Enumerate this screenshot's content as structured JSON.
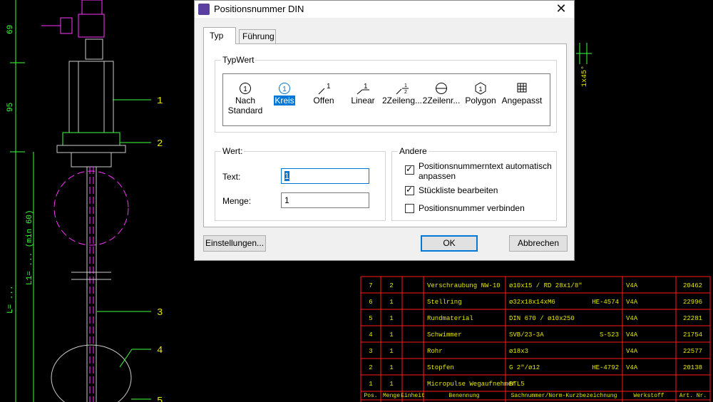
{
  "window": {
    "title": "Positionsnummer DIN",
    "close_glyph": "✕"
  },
  "tabs": [
    {
      "label": "Typ",
      "active": true
    },
    {
      "label": "Führung",
      "active": false
    }
  ],
  "typwert": {
    "label": "TypWert",
    "items": [
      {
        "label": "Nach Standard",
        "icon": "circle-one-icon",
        "selected": false
      },
      {
        "label": "Kreis",
        "icon": "circle-one-icon",
        "selected": true
      },
      {
        "label": "Offen",
        "icon": "leader-open-icon",
        "selected": false
      },
      {
        "label": "Linear",
        "icon": "leader-linear-icon",
        "selected": false
      },
      {
        "label": "2Zeileng...",
        "icon": "two-line-fraction-icon",
        "selected": false
      },
      {
        "label": "2Zeilenr...",
        "icon": "two-line-circle-icon",
        "selected": false
      },
      {
        "label": "Polygon",
        "icon": "polygon-icon",
        "selected": false
      },
      {
        "label": "Angepasst",
        "icon": "grid-icon",
        "selected": false
      }
    ]
  },
  "wert": {
    "label": "Wert:",
    "text_label": "Text:",
    "text_value": "1",
    "menge_label": "Menge:",
    "menge_value": "1"
  },
  "andere": {
    "label": "Andere",
    "options": [
      {
        "label": "Positionsnummerntext automatisch anpassen",
        "checked": true
      },
      {
        "label": "Stückliste bearbeiten",
        "checked": true
      },
      {
        "label": "Positionsnummer verbinden",
        "checked": false
      }
    ]
  },
  "buttons": {
    "settings": "Einstellungen...",
    "ok": "OK",
    "cancel": "Abbrechen"
  },
  "cad": {
    "dim_left_1": "69",
    "dim_left_2": "95",
    "dim_left_3": "L1= ... (min 60)",
    "dim_left_4": "L= ...",
    "chamfer": "1x45°",
    "balloons": [
      "1",
      "2",
      "3",
      "4",
      "5"
    ],
    "bom_rows": [
      {
        "pos": "7",
        "menge": "2",
        "benennung": "Verschraubung NW-10",
        "sach": "ø10x15 / RD 28x1/8\"",
        "norm": "",
        "werkstoff": "V4A",
        "art": "20462"
      },
      {
        "pos": "6",
        "menge": "1",
        "benennung": "Stellring",
        "sach": "ø32x18x14xM6",
        "norm": "HE-4574",
        "werkstoff": "V4A",
        "art": "22996"
      },
      {
        "pos": "5",
        "menge": "1",
        "benennung": "Rundmaterial",
        "sach": "DIN 670 / ø10x250",
        "norm": "",
        "werkstoff": "V4A",
        "art": "22281"
      },
      {
        "pos": "4",
        "menge": "1",
        "benennung": "Schwimmer",
        "sach": "SVB/23-3A",
        "norm": "S-523",
        "werkstoff": "V4A",
        "art": "21754"
      },
      {
        "pos": "3",
        "menge": "1",
        "benennung": "Rohr",
        "sach": "ø18x3",
        "norm": "",
        "werkstoff": "V4A",
        "art": "22577"
      },
      {
        "pos": "2",
        "menge": "1",
        "benennung": "Stopfen",
        "sach": "G 2\"/ø12",
        "norm": "HE-4792",
        "werkstoff": "V4A",
        "art": "20138"
      },
      {
        "pos": "1",
        "menge": "1",
        "benennung": "Micropulse Wegaufnehmer",
        "sach": "BTL5",
        "norm": "",
        "werkstoff": "",
        "art": ""
      }
    ],
    "bom_header": {
      "pos": "Pos.",
      "menge": "Menge",
      "einheit": "Einheit",
      "benennung": "Benennung",
      "sach": "Sachnummer/Norm-Kurzbezeichnung",
      "werkstoff": "Werkstoff",
      "art": "Art. Nr."
    }
  },
  "colors": {
    "cad_green": "#3cff3c",
    "cad_magenta": "#ff33ff",
    "cad_yellow": "#e6e600",
    "cad_red": "#ff1a1a",
    "accent": "#0078d7"
  }
}
